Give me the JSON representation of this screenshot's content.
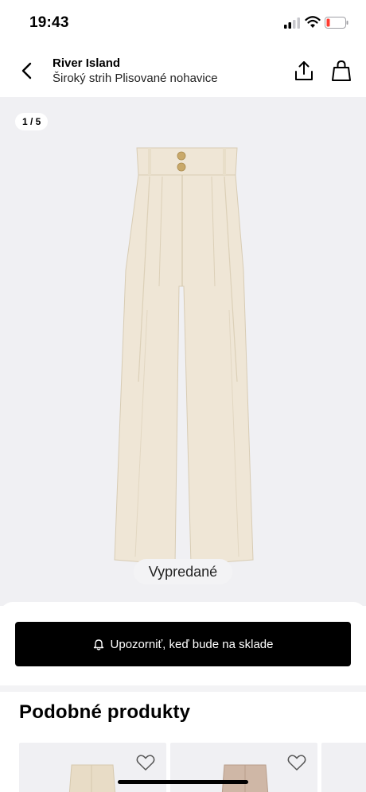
{
  "status_bar": {
    "time": "19:43"
  },
  "header": {
    "brand": "River Island",
    "product_name": "Široký strih Plisované nohavice"
  },
  "gallery": {
    "counter": "1 / 5",
    "soldout_label": "Vypredané",
    "product_color": "#efe6d6"
  },
  "notify": {
    "label": "Upozorniť, keď bude na sklade"
  },
  "similar": {
    "title": "Podobné produkty"
  },
  "icons": {
    "back": "chevron-left-icon",
    "share": "share-icon",
    "bag": "shopping-bag-icon",
    "bell": "bell-icon",
    "heart": "heart-icon"
  }
}
